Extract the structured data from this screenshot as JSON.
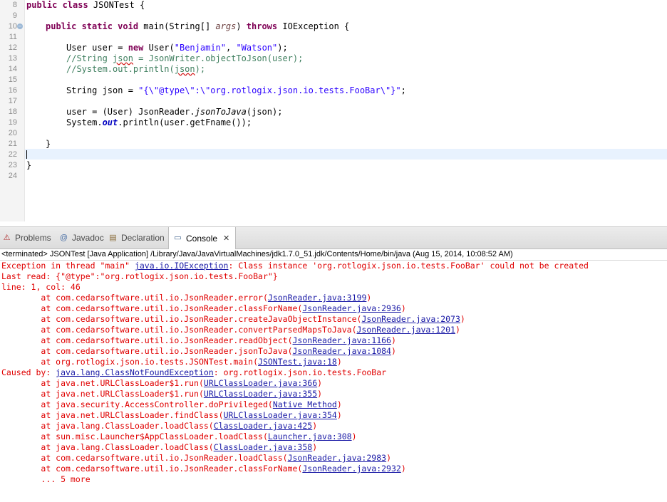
{
  "editor": {
    "line_numbers": [
      "8",
      "9",
      "10",
      "11",
      "12",
      "13",
      "14",
      "15",
      "16",
      "17",
      "18",
      "19",
      "20",
      "21",
      "22",
      "23",
      "24"
    ],
    "code": {
      "l8_kw": "public class",
      "l8_rest": " JSONTest {",
      "l10_kw1": "public static void",
      "l10_mid": " main(String[] ",
      "l10_args": "args",
      "l10_close": ") ",
      "l10_kw2": "throws",
      "l10_rest": " IOException {",
      "l12_a": "User user = ",
      "l12_kw": "new",
      "l12_b": " User(",
      "l12_s1": "\"Benjamin\"",
      "l12_c": ", ",
      "l12_s2": "\"Watson\"",
      "l12_d": ");",
      "l13_a": "//String ",
      "l13_json": "json",
      "l13_b": " = JsonWriter.objectToJson(user);",
      "l14_a": "//System.out.println(",
      "l14_json": "json",
      "l14_b": ");",
      "l16_a": "String json = ",
      "l16_s": "\"{\\\"@type\\\":\\\"org.rotlogix.json.io.tests.FooBar\\\"}\"",
      "l16_b": ";",
      "l18_a": "user = (User) JsonReader.",
      "l18_it": "jsonToJava",
      "l18_b": "(json);",
      "l19_a": "System.",
      "l19_fld": "out",
      "l19_b": ".println(user.getFname());",
      "l21": "}",
      "l23": "}"
    }
  },
  "tabs": [
    {
      "label": "Problems",
      "icon": "problems-icon"
    },
    {
      "label": "Javadoc",
      "icon": "javadoc-icon"
    },
    {
      "label": "Declaration",
      "icon": "declaration-icon"
    },
    {
      "label": "Console",
      "icon": "console-icon"
    }
  ],
  "console": {
    "header": "<terminated> JSONTest [Java Application] /Library/Java/JavaVirtualMachines/jdk1.7.0_51.jdk/Contents/Home/bin/java (Aug 15, 2014, 10:08:52 AM)",
    "lines": {
      "l1a": "Exception in thread \"main\" ",
      "l1link": "java.io.IOException",
      "l1b": ": Class instance 'org.rotlogix.json.io.tests.FooBar' could not be created",
      "l2": "Last read: {\"@type\":\"org.rotlogix.json.io.tests.FooBar\"}",
      "l3": "line: 1, col: 46",
      "caused_a": "Caused by: ",
      "caused_link": "java.lang.ClassNotFoundException",
      "caused_b": ": org.rotlogix.json.io.tests.FooBar",
      "more": "\t... 5 more"
    },
    "stack1": [
      {
        "pre": "\tat com.cedarsoftware.util.io.JsonReader.error(",
        "link": "JsonReader.java:3199",
        "post": ")"
      },
      {
        "pre": "\tat com.cedarsoftware.util.io.JsonReader.classForName(",
        "link": "JsonReader.java:2936",
        "post": ")"
      },
      {
        "pre": "\tat com.cedarsoftware.util.io.JsonReader.createJavaObjectInstance(",
        "link": "JsonReader.java:2073",
        "post": ")"
      },
      {
        "pre": "\tat com.cedarsoftware.util.io.JsonReader.convertParsedMapsToJava(",
        "link": "JsonReader.java:1201",
        "post": ")"
      },
      {
        "pre": "\tat com.cedarsoftware.util.io.JsonReader.readObject(",
        "link": "JsonReader.java:1166",
        "post": ")"
      },
      {
        "pre": "\tat com.cedarsoftware.util.io.JsonReader.jsonToJava(",
        "link": "JsonReader.java:1084",
        "post": ")"
      },
      {
        "pre": "\tat org.rotlogix.json.io.tests.JSONTest.main(",
        "link": "JSONTest.java:18",
        "post": ")"
      }
    ],
    "stack2": [
      {
        "pre": "\tat java.net.URLClassLoader$1.run(",
        "link": "URLClassLoader.java:366",
        "post": ")"
      },
      {
        "pre": "\tat java.net.URLClassLoader$1.run(",
        "link": "URLClassLoader.java:355",
        "post": ")"
      },
      {
        "pre": "\tat java.security.AccessController.doPrivileged(",
        "link": "Native Method",
        "post": ")"
      },
      {
        "pre": "\tat java.net.URLClassLoader.findClass(",
        "link": "URLClassLoader.java:354",
        "post": ")"
      },
      {
        "pre": "\tat java.lang.ClassLoader.loadClass(",
        "link": "ClassLoader.java:425",
        "post": ")"
      },
      {
        "pre": "\tat sun.misc.Launcher$AppClassLoader.loadClass(",
        "link": "Launcher.java:308",
        "post": ")"
      },
      {
        "pre": "\tat java.lang.ClassLoader.loadClass(",
        "link": "ClassLoader.java:358",
        "post": ")"
      },
      {
        "pre": "\tat com.cedarsoftware.util.io.JsonReader.loadClass(",
        "link": "JsonReader.java:2983",
        "post": ")"
      },
      {
        "pre": "\tat com.cedarsoftware.util.io.JsonReader.classForName(",
        "link": "JsonReader.java:2932",
        "post": ")"
      }
    ]
  },
  "colors": {
    "error": "#e00000",
    "link": "#1a1aa6",
    "keyword": "#7f0055",
    "string": "#2a00ff",
    "comment": "#3f7f5f"
  }
}
